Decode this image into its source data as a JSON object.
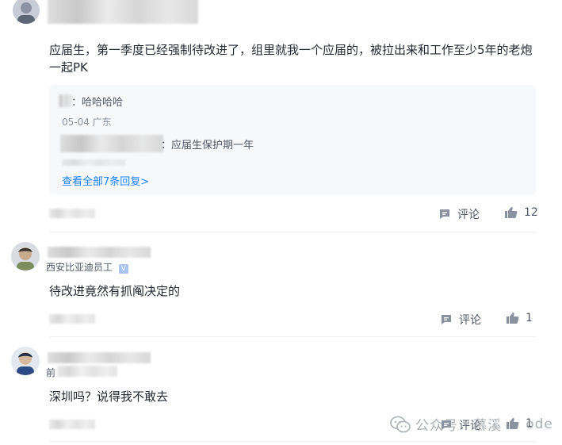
{
  "comments": [
    {
      "text": "应届生，第一季度已经强制待改进了，组里就我一个应届的，被拉出来和工作至少5年的老炮一起PK",
      "reply_preview": {
        "first_line": "：哈哈哈哈",
        "date_location": "05-04 广东",
        "second_line": "：应届生保护期一年",
        "view_all": "查看全部7条回复>"
      },
      "comment_label": "评论",
      "like_count": "12"
    },
    {
      "author_desc": "西安比亚迪员工",
      "badge": "V",
      "text": "待改进竟然有抓阄决定的",
      "comment_label": "评论",
      "like_count": "1"
    },
    {
      "author_desc": "前",
      "text": "深圳吗？说得我不敢去",
      "comment_label": "评论",
      "like_count": "1"
    }
  ],
  "watermark": "公众号 · 慕溪",
  "watermark_tail": "ode",
  "colors": {
    "text": "#252933",
    "meta": "#8a919f",
    "link": "#1e80ff",
    "reply_bg": "#f7f8fa"
  },
  "icons": [
    "avatar",
    "comment-icon",
    "like-icon",
    "verified-badge-icon",
    "wechat-icon"
  ]
}
